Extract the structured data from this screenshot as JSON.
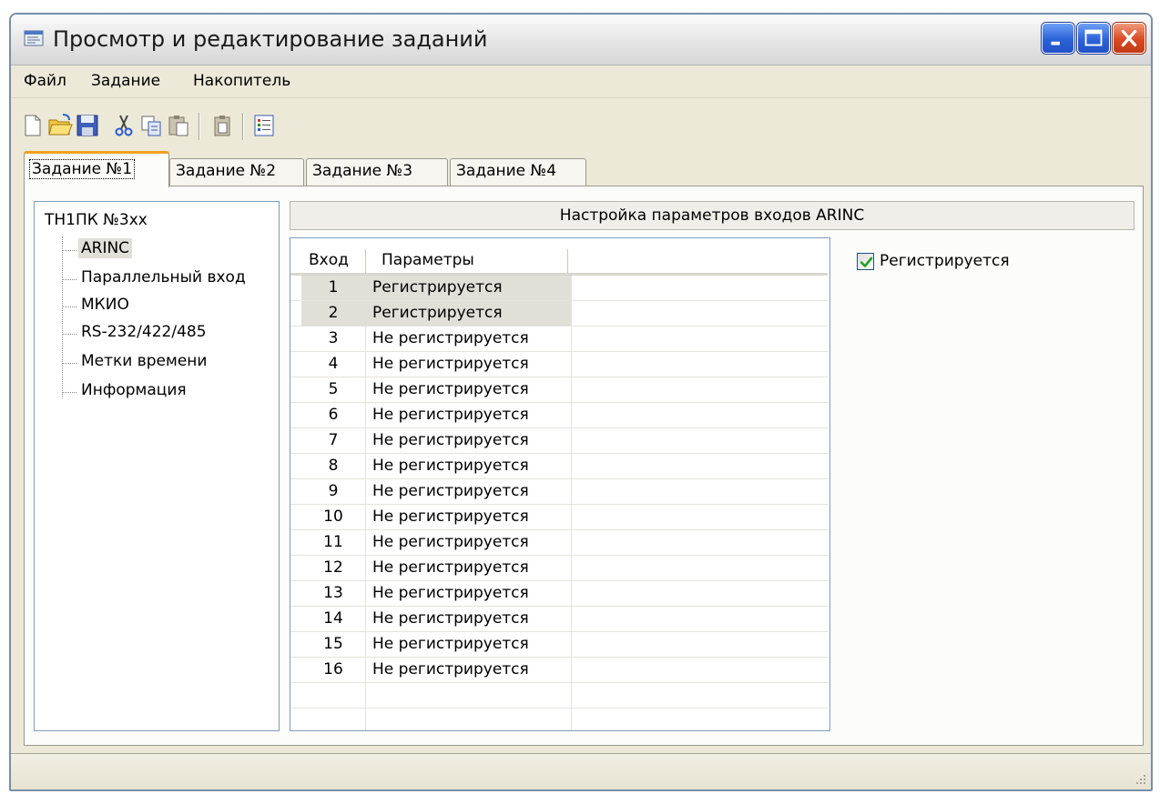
{
  "window": {
    "title": "Просмотр и редактирование заданий",
    "icon": "window-app-icon",
    "controls": [
      "minimize-icon",
      "maximize-icon",
      "close-icon"
    ]
  },
  "menu": {
    "items": [
      "Файл",
      "Задание",
      "Накопитель"
    ]
  },
  "toolbar": {
    "buttons": [
      "new-document-icon",
      "open-folder-icon",
      "save-icon",
      "cut-icon",
      "copy-icon",
      "paste-icon",
      "paste-special-icon",
      "properties-list-icon"
    ]
  },
  "tabs": {
    "items": [
      "Задание №1",
      "Задание №2",
      "Задание №3",
      "Задание №4"
    ],
    "active_index": 0
  },
  "tree": {
    "root": "ТН1ПК №3хх",
    "items": [
      "ARINC",
      "Параллельный вход",
      "МКИО",
      "RS-232/422/485",
      "Метки времени",
      "Информация"
    ],
    "selected": "ARINC"
  },
  "panel": {
    "title": "Настройка параметров входов ARINC"
  },
  "grid": {
    "columns": [
      "Вход",
      "Параметры"
    ],
    "rows": [
      {
        "num": "1",
        "param": "Регистрируется"
      },
      {
        "num": "2",
        "param": "Регистрируется"
      },
      {
        "num": "3",
        "param": "Не регистрируется"
      },
      {
        "num": "4",
        "param": "Не регистрируется"
      },
      {
        "num": "5",
        "param": "Не регистрируется"
      },
      {
        "num": "6",
        "param": "Не регистрируется"
      },
      {
        "num": "7",
        "param": "Не регистрируется"
      },
      {
        "num": "8",
        "param": "Не регистрируется"
      },
      {
        "num": "9",
        "param": "Не регистрируется"
      },
      {
        "num": "10",
        "param": "Не регистрируется"
      },
      {
        "num": "11",
        "param": "Не регистрируется"
      },
      {
        "num": "12",
        "param": "Не регистрируется"
      },
      {
        "num": "13",
        "param": "Не регистрируется"
      },
      {
        "num": "14",
        "param": "Не регистрируется"
      },
      {
        "num": "15",
        "param": "Не регистрируется"
      },
      {
        "num": "16",
        "param": "Не регистрируется"
      }
    ],
    "selected_rows": [
      0,
      1
    ]
  },
  "checkbox": {
    "label": "Регистрируется",
    "checked": true
  },
  "colors": {
    "window_bg": "#ece9d8",
    "panel_bg": "#fcfcfa",
    "active_tab_accent": "#f0a020",
    "selection": "#e0dfd8",
    "checkmark": "#21a121"
  }
}
